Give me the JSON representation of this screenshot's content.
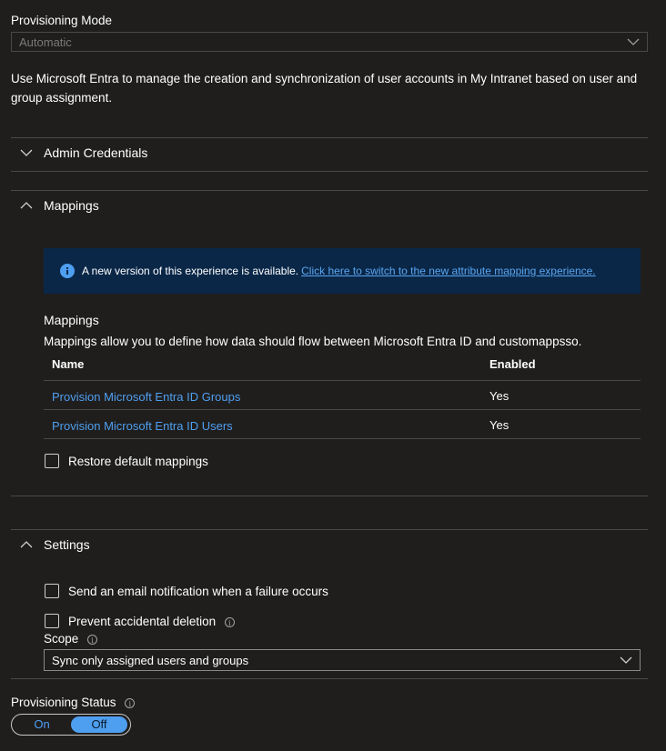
{
  "provisioning_mode": {
    "label": "Provisioning Mode",
    "value": "Automatic",
    "description": "Use Microsoft Entra to manage the creation and synchronization of user accounts in My Intranet based on user and group assignment."
  },
  "admin_credentials": {
    "label": "Admin Credentials"
  },
  "mappings_section": {
    "label": "Mappings",
    "banner_text": "A new version of this experience is available.",
    "banner_link": "Click here to switch to the new attribute mapping experience.",
    "title": "Mappings",
    "description": "Mappings allow you to define how data should flow between Microsoft Entra ID and customappsso.",
    "table": {
      "headers": [
        "Name",
        "Enabled"
      ],
      "rows": [
        {
          "name": "Provision Microsoft Entra ID Groups",
          "enabled": "Yes"
        },
        {
          "name": "Provision Microsoft Entra ID Users",
          "enabled": "Yes"
        }
      ]
    },
    "restore_label": "Restore default mappings"
  },
  "settings": {
    "label": "Settings",
    "email_notification_label": "Send an email notification when a failure occurs",
    "prevent_deletion_label": "Prevent accidental deletion",
    "scope_label": "Scope",
    "scope_value": "Sync only assigned users and groups"
  },
  "provisioning_status": {
    "label": "Provisioning Status",
    "on_label": "On",
    "off_label": "Off",
    "selected": "Off"
  },
  "colors": {
    "background": "#1f1e1d",
    "link": "#4f9ff0",
    "banner": "#0a2748",
    "accent": "#4f9ff0"
  }
}
